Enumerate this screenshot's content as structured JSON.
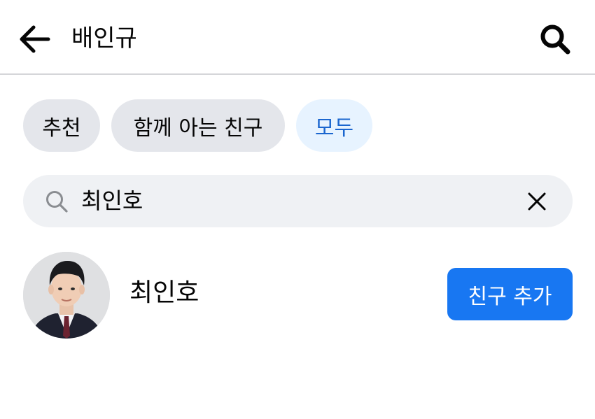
{
  "header": {
    "back_icon": "arrow-left-icon",
    "title": "배인규",
    "search_icon": "search-icon"
  },
  "filters": [
    {
      "label": "추천",
      "selected": false
    },
    {
      "label": "함께 아는 친구",
      "selected": false
    },
    {
      "label": "모두",
      "selected": true
    }
  ],
  "search": {
    "icon": "search-icon",
    "value": "최인호",
    "clear_icon": "close-icon"
  },
  "results": [
    {
      "name": "최인호",
      "action_label": "친구 추가"
    }
  ],
  "colors": {
    "accent": "#1877f2",
    "chip_bg": "#e4e6eb",
    "chip_selected_bg": "#e7f3ff",
    "chip_selected_text": "#1b66cf",
    "search_bg": "#eff1f4",
    "divider": "#d5d6d9"
  }
}
